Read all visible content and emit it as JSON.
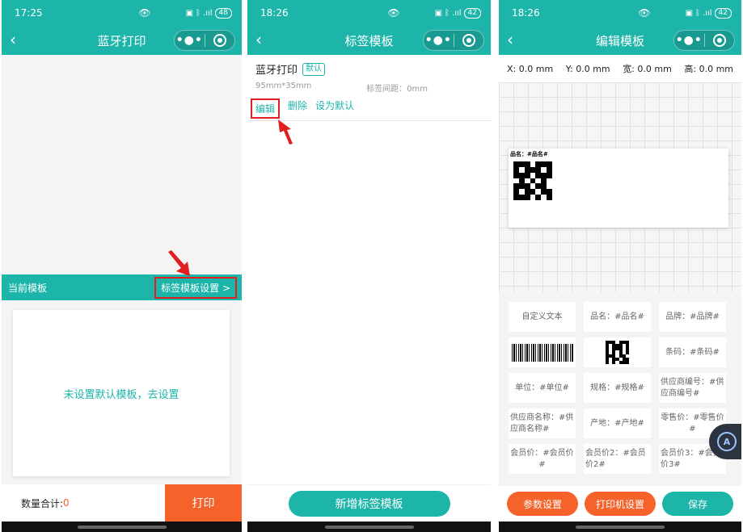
{
  "phone1": {
    "status": {
      "time": "17:25",
      "battery": "48"
    },
    "nav": {
      "title": "蓝牙打印"
    },
    "current_template_label": "当前模板",
    "template_settings_link": "标签模板设置 >",
    "empty_message": "未设置默认模板，去设置",
    "quantity_label": "数量合计:",
    "quantity_value": "0",
    "print_button": "打印"
  },
  "phone2": {
    "status": {
      "time": "18:26",
      "battery": "42"
    },
    "nav": {
      "title": "标签模板"
    },
    "template": {
      "name": "蓝牙打印",
      "badge": "默认",
      "size": "95mm*35mm",
      "gap": "标签间距：0mm",
      "actions": {
        "edit": "编辑",
        "delete": "删除",
        "set_default": "设为默认"
      }
    },
    "add_button": "新增标签模板"
  },
  "phone3": {
    "status": {
      "time": "18:26",
      "battery": "42"
    },
    "nav": {
      "title": "编辑模板"
    },
    "coords": {
      "x": "X: 0.0 mm",
      "y": "Y: 0.0 mm",
      "width": "宽: 0.0 mm",
      "height": "高: 0.0 mm"
    },
    "label_text": "品名：#品名#",
    "palette": [
      {
        "text": "自定义文本",
        "type": "text"
      },
      {
        "text": "品名：#品名#",
        "type": "text"
      },
      {
        "text": "品牌：#品牌#",
        "type": "text"
      },
      {
        "text": "",
        "type": "barcode"
      },
      {
        "text": "",
        "type": "qrcode"
      },
      {
        "text": "条码：#条码#",
        "type": "text"
      },
      {
        "text": "单位：#单位#",
        "type": "text"
      },
      {
        "text": "规格：#规格#",
        "type": "text"
      },
      {
        "text": "供应商编号：#供应商编号#",
        "type": "text"
      },
      {
        "text": "供应商名称：#供应商名称#",
        "type": "text"
      },
      {
        "text": "产地：#产地#",
        "type": "text"
      },
      {
        "text": "零售价：#零售价#",
        "type": "text"
      },
      {
        "text": "会员价：#会员价#",
        "type": "text"
      },
      {
        "text": "会员价2：#会员价2#",
        "type": "text"
      },
      {
        "text": "会员价3：#会员价3#",
        "type": "text"
      }
    ],
    "buttons": {
      "params": "参数设置",
      "printer": "打印机设置",
      "save": "保存"
    }
  },
  "colors": {
    "teal": "#1db5aa",
    "orange": "#f5622a",
    "highlight_red": "#e02020"
  }
}
